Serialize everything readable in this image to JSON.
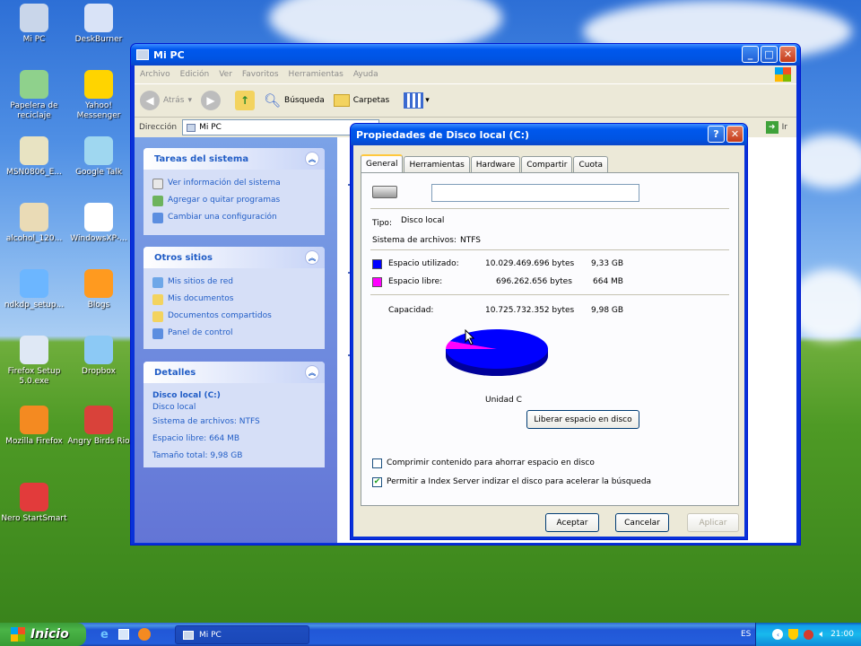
{
  "desktop": {
    "icons": [
      {
        "label": "Mi PC",
        "icon": "computer-icon",
        "color": "#c9d6ea"
      },
      {
        "label": "DeskBurner",
        "icon": "db-icon",
        "color": "#d9e3f7"
      },
      {
        "label": "Papelera de reciclaje",
        "icon": "recycle-bin-icon",
        "color": "#8fd18c"
      },
      {
        "label": "Yahoo! Messenger",
        "icon": "yahoo-messenger-icon",
        "color": "#ffd400"
      },
      {
        "label": "MSN0806_E...",
        "icon": "msn-installer-icon",
        "color": "#e8e3c2"
      },
      {
        "label": "Google Talk",
        "icon": "google-talk-icon",
        "color": "#9fd7f0"
      },
      {
        "label": "alcohol_120...",
        "icon": "alcohol-installer-icon",
        "color": "#eadbb6"
      },
      {
        "label": "WindowsXP-...",
        "icon": "window-file-icon",
        "color": "#ffffff"
      },
      {
        "label": "ndkdp_setup...",
        "icon": "setup-icon",
        "color": "#6cb6ff"
      },
      {
        "label": "Blogs",
        "icon": "blogs-icon",
        "color": "#ff9a1f"
      },
      {
        "label": "Firefox Setup 5.0.exe",
        "icon": "firefox-setup-icon",
        "color": "#dfe8f5"
      },
      {
        "label": "Dropbox",
        "icon": "dropbox-icon",
        "color": "#8cc9f5"
      },
      {
        "label": "Mozilla Firefox",
        "icon": "firefox-icon",
        "color": "#f48a21"
      },
      {
        "label": "Angry Birds Rio",
        "icon": "angry-birds-icon",
        "color": "#d9423a"
      },
      {
        "label": "Nero StartSmart",
        "icon": "nero-icon",
        "color": "#e23b3b"
      }
    ]
  },
  "window": {
    "title": "Mi PC",
    "menu": [
      "Archivo",
      "Edición",
      "Ver",
      "Favoritos",
      "Herramientas",
      "Ayuda"
    ],
    "toolbar": {
      "back": "Atrás",
      "search": "Búsqueda",
      "folders": "Carpetas"
    },
    "address_label": "Dirección",
    "address_value": "Mi PC",
    "go_label": "Ir"
  },
  "tasks": {
    "title": "Tareas del sistema",
    "items": [
      "Ver información del sistema",
      "Agregar o quitar programas",
      "Cambiar una configuración"
    ]
  },
  "places": {
    "title": "Otros sitios",
    "items": [
      "Mis sitios de red",
      "Mis documentos",
      "Documentos compartidos",
      "Panel de control"
    ]
  },
  "details": {
    "title": "Detalles",
    "name": "Disco local (C:)",
    "type": "Disco local",
    "fs": "Sistema de archivos: NTFS",
    "free": "Espacio libre: 664 MB",
    "total": "Tamaño total: 9,98 GB"
  },
  "dialog": {
    "title": "Propiedades de Disco local (C:)",
    "tabs": [
      "General",
      "Herramientas",
      "Hardware",
      "Compartir",
      "Cuota"
    ],
    "label_value": "",
    "type_label": "Tipo:",
    "type_value": "Disco local",
    "fs_label": "Sistema de archivos:",
    "fs_value": "NTFS",
    "used_label": "Espacio utilizado:",
    "used_bytes": "10.029.469.696 bytes",
    "used_size": "9,33 GB",
    "free_label": "Espacio libre:",
    "free_bytes": "696.262.656 bytes",
    "free_size": "664 MB",
    "cap_label": "Capacidad:",
    "cap_bytes": "10.725.732.352 bytes",
    "cap_size": "9,98 GB",
    "drive_label": "Unidad C",
    "cleanup_button": "Liberar espacio en disco",
    "compress_label": "Comprimir contenido para ahorrar espacio en disco",
    "index_label": "Permitir a Index Server indizar el disco para acelerar la búsqueda",
    "compress_checked": false,
    "index_checked": true,
    "ok": "Aceptar",
    "cancel": "Cancelar",
    "apply": "Aplicar",
    "used_color": "#0000ff",
    "free_color": "#ff00ff",
    "used_fraction": 0.935
  },
  "taskbar": {
    "start": "Inicio",
    "task": "Mi PC",
    "lang": "ES",
    "clock": "21:00"
  }
}
